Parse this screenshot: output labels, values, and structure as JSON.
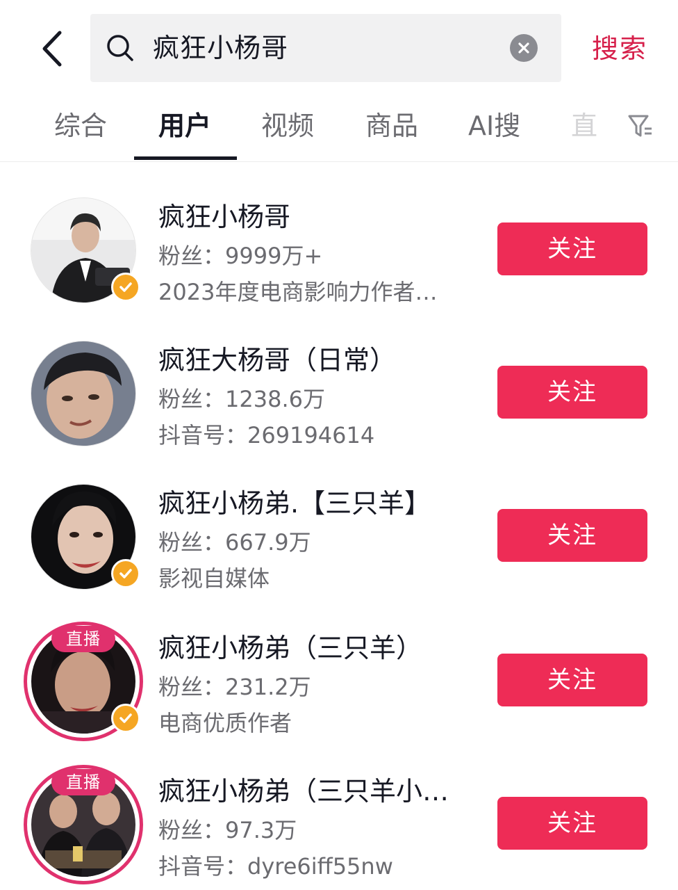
{
  "header": {
    "search_value": "疯狂小杨哥",
    "search_button": "搜索"
  },
  "tabs": [
    {
      "label": "综合"
    },
    {
      "label": "用户"
    },
    {
      "label": "视频"
    },
    {
      "label": "商品"
    },
    {
      "label": "AI搜"
    },
    {
      "label": "直"
    }
  ],
  "results": [
    {
      "name": "疯狂小杨哥",
      "fans": "粉丝：9999万+",
      "desc": "2023年度电商影响力作者…",
      "follow": "关注",
      "verified": true,
      "live": false,
      "live_label": ""
    },
    {
      "name": "疯狂大杨哥（日常）",
      "fans": "粉丝：1238.6万",
      "desc": "抖音号：269194614",
      "follow": "关注",
      "verified": false,
      "live": false,
      "live_label": ""
    },
    {
      "name": "疯狂小杨弟.【三只羊】",
      "fans": "粉丝：667.9万",
      "desc": "影视自媒体",
      "follow": "关注",
      "verified": true,
      "live": false,
      "live_label": ""
    },
    {
      "name": "疯狂小杨弟（三只羊）",
      "fans": "粉丝：231.2万",
      "desc": "电商优质作者",
      "follow": "关注",
      "verified": true,
      "live": true,
      "live_label": "直播"
    },
    {
      "name": "疯狂小杨弟（三只羊小…",
      "fans": "粉丝：97.3万",
      "desc": "抖音号：dyre6iff55nw",
      "follow": "关注",
      "verified": false,
      "live": true,
      "live_label": "直播"
    }
  ],
  "colors": {
    "accent": "#ee2c56",
    "search_accent": "#d61f4a",
    "live": "#e0316d",
    "verified": "#f5a623"
  },
  "icons": {
    "back": "chevron-left-icon",
    "search": "search-icon",
    "clear": "close-icon",
    "filter": "filter-icon",
    "verified": "check-badge-icon"
  }
}
